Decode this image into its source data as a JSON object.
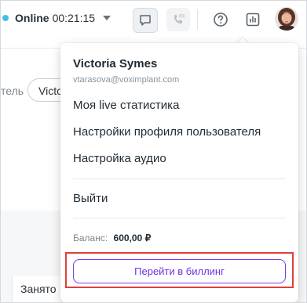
{
  "header": {
    "status_label": "Online",
    "status_time": "00:21:15",
    "icons": [
      "chat-icon",
      "phone-icon",
      "help-icon",
      "stats-icon"
    ]
  },
  "background": {
    "filter_label": "тель",
    "pill_text": "Victo",
    "cell_text": "Занято"
  },
  "menu": {
    "user_name": "Victoria Symes",
    "user_email": "vtarasova@voximplant.com",
    "items": [
      {
        "label": "Моя live статистика"
      },
      {
        "label": "Настройки профиля пользователя"
      },
      {
        "label": "Настройка аудио"
      }
    ],
    "logout_label": "Выйти",
    "balance_label": "Баланс:",
    "balance_value": "600,00 ₽",
    "billing_button": "Перейти в биллинг"
  },
  "colors": {
    "accent": "#7a3cf0",
    "status": "#3fc1e6",
    "highlight": "#e0403a"
  }
}
